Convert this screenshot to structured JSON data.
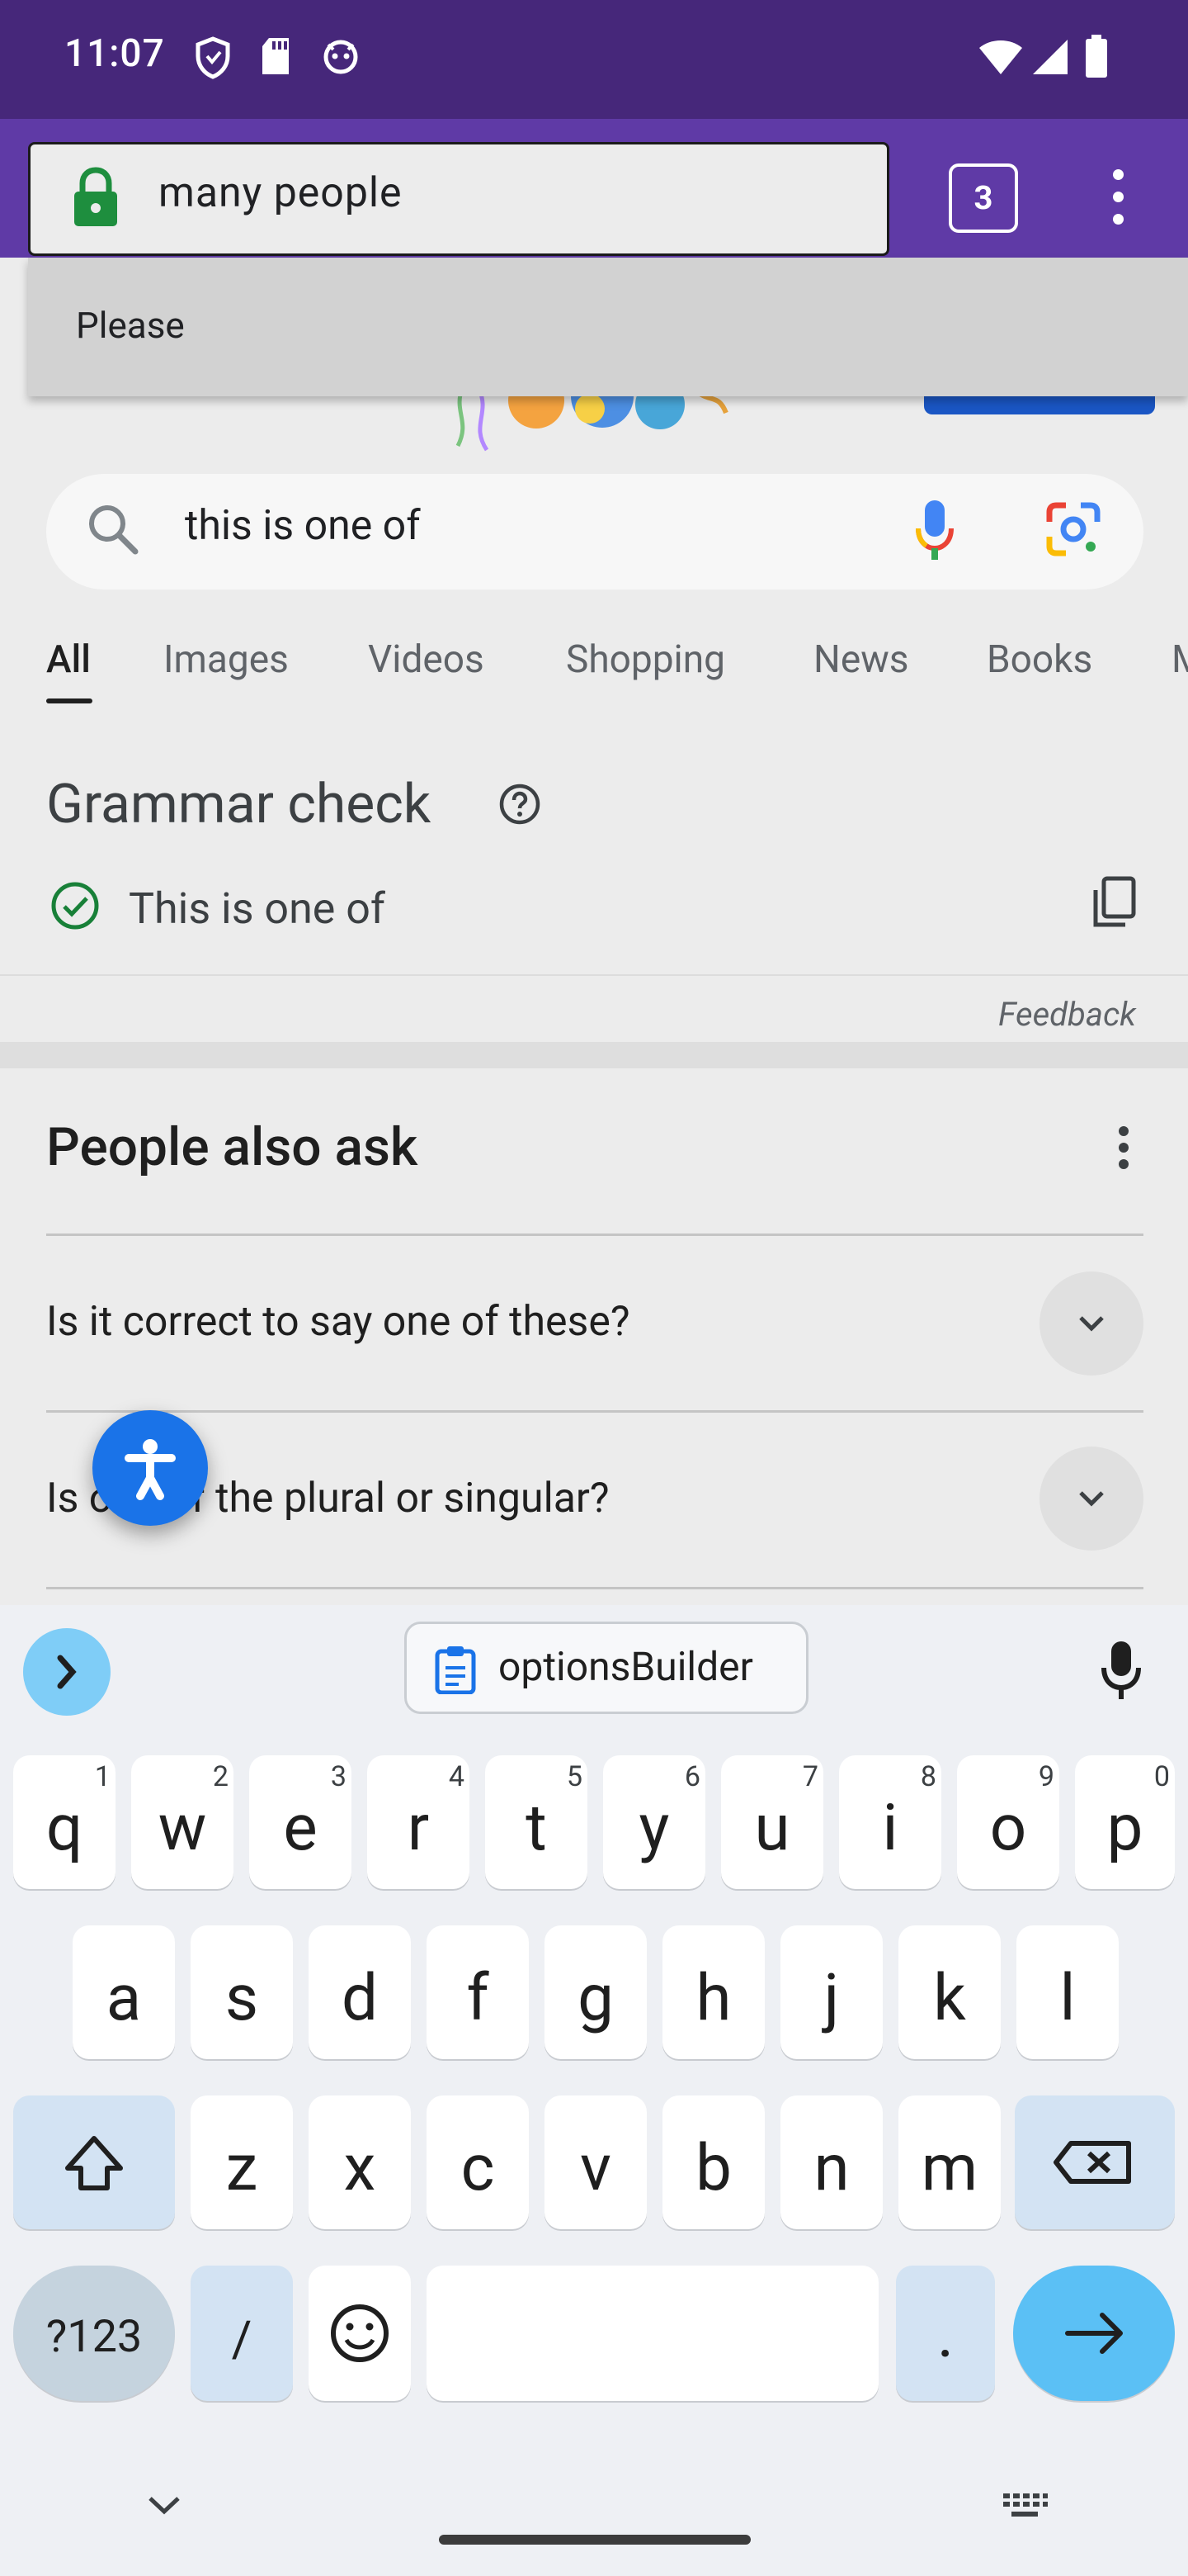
{
  "status_bar": {
    "time": "11:07"
  },
  "browser": {
    "url_text": "many  people",
    "tab_count": "3",
    "suggestion": "Please"
  },
  "search": {
    "query": "this is one of",
    "tabs": [
      "All",
      "Images",
      "Videos",
      "Shopping",
      "News",
      "Books",
      "M"
    ],
    "active_tab": "All"
  },
  "grammar_check": {
    "title": "Grammar check",
    "result": "This is one of",
    "feedback": "Feedback"
  },
  "people_also_ask": {
    "title": "People also ask",
    "questions": [
      "Is it correct to say one of these?",
      "Is one of the plural or singular?"
    ]
  },
  "keyboard": {
    "clipboard_chip": "optionsBuilder",
    "row1": [
      {
        "k": "q",
        "n": "1"
      },
      {
        "k": "w",
        "n": "2"
      },
      {
        "k": "e",
        "n": "3"
      },
      {
        "k": "r",
        "n": "4"
      },
      {
        "k": "t",
        "n": "5"
      },
      {
        "k": "y",
        "n": "6"
      },
      {
        "k": "u",
        "n": "7"
      },
      {
        "k": "i",
        "n": "8"
      },
      {
        "k": "o",
        "n": "9"
      },
      {
        "k": "p",
        "n": "0"
      }
    ],
    "row2": [
      "a",
      "s",
      "d",
      "f",
      "g",
      "h",
      "j",
      "k",
      "l"
    ],
    "row3": [
      "z",
      "x",
      "c",
      "v",
      "b",
      "n",
      "m"
    ],
    "symbols_key": "?123",
    "slash_key": "/",
    "period_key": "."
  },
  "colors": {
    "status_bar": "#46277a",
    "toolbar": "#5f3aa6",
    "accent_blue": "#1a73e8",
    "enter_key": "#5bc0f5"
  }
}
